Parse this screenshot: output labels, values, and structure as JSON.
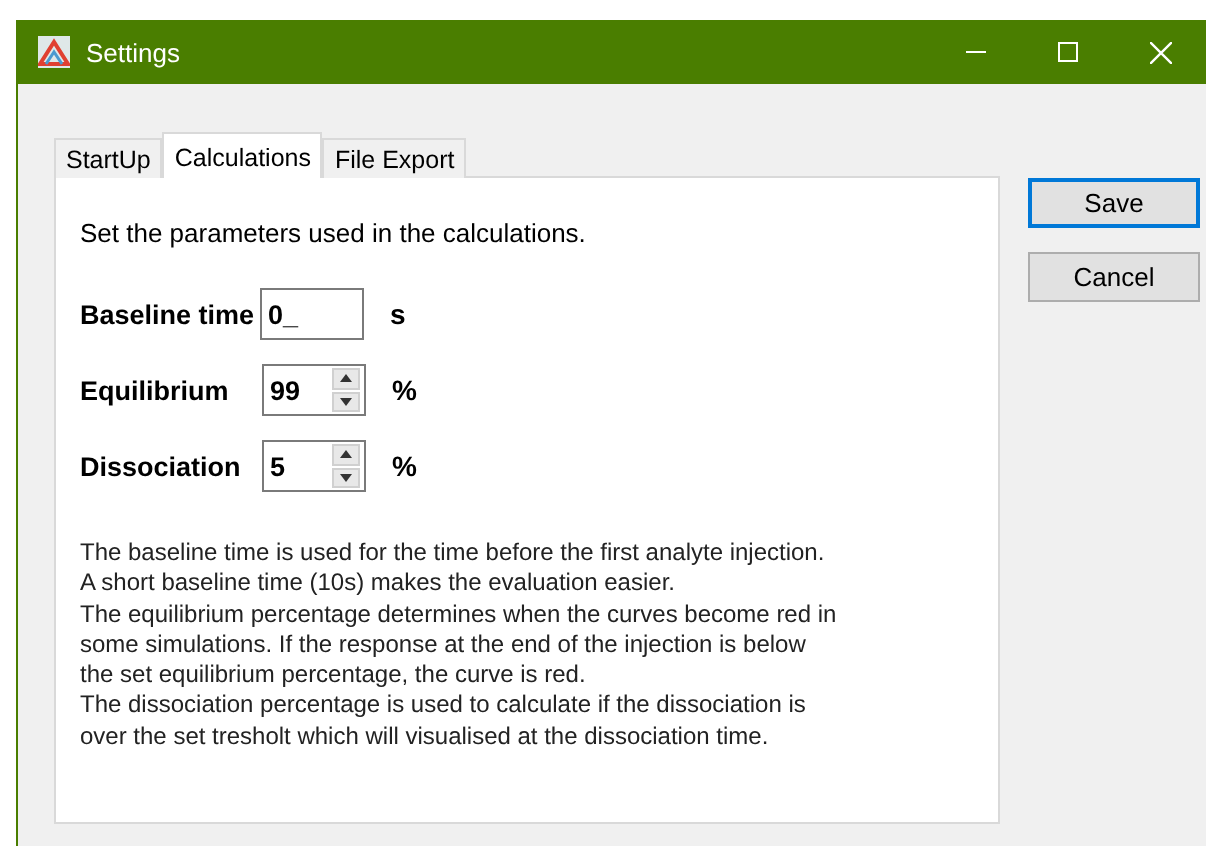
{
  "window": {
    "title": "Settings"
  },
  "tabs": [
    {
      "label": "StartUp",
      "selected": false
    },
    {
      "label": "Calculations",
      "selected": true
    },
    {
      "label": "File Export",
      "selected": false
    }
  ],
  "intro": "Set the parameters used in the calculations.",
  "fields": [
    {
      "kind": "text",
      "label": "Baseline time",
      "value": "0_",
      "unit": "s"
    },
    {
      "kind": "spinner",
      "label": "Equilibrium",
      "value": "99",
      "unit": "%"
    },
    {
      "kind": "spinner",
      "label": "Dissociation",
      "value": "5",
      "unit": "%"
    }
  ],
  "description": [
    "The baseline time is used for the time before the first analyte injection.",
    "A short baseline time (10s) makes the evaluation easier.",
    "The equilibrium percentage determines when the curves become red in",
    "some simulations. If the response at the end of the injection is below",
    "the set equilibrium percentage, the curve is red.",
    "The dissociation percentage is used to calculate if the dissociation is",
    "over the set tresholt which will visualised at the dissociation time."
  ],
  "buttons": [
    {
      "label": "Save",
      "selected": true
    },
    {
      "label": "Cancel",
      "selected": false
    }
  ]
}
